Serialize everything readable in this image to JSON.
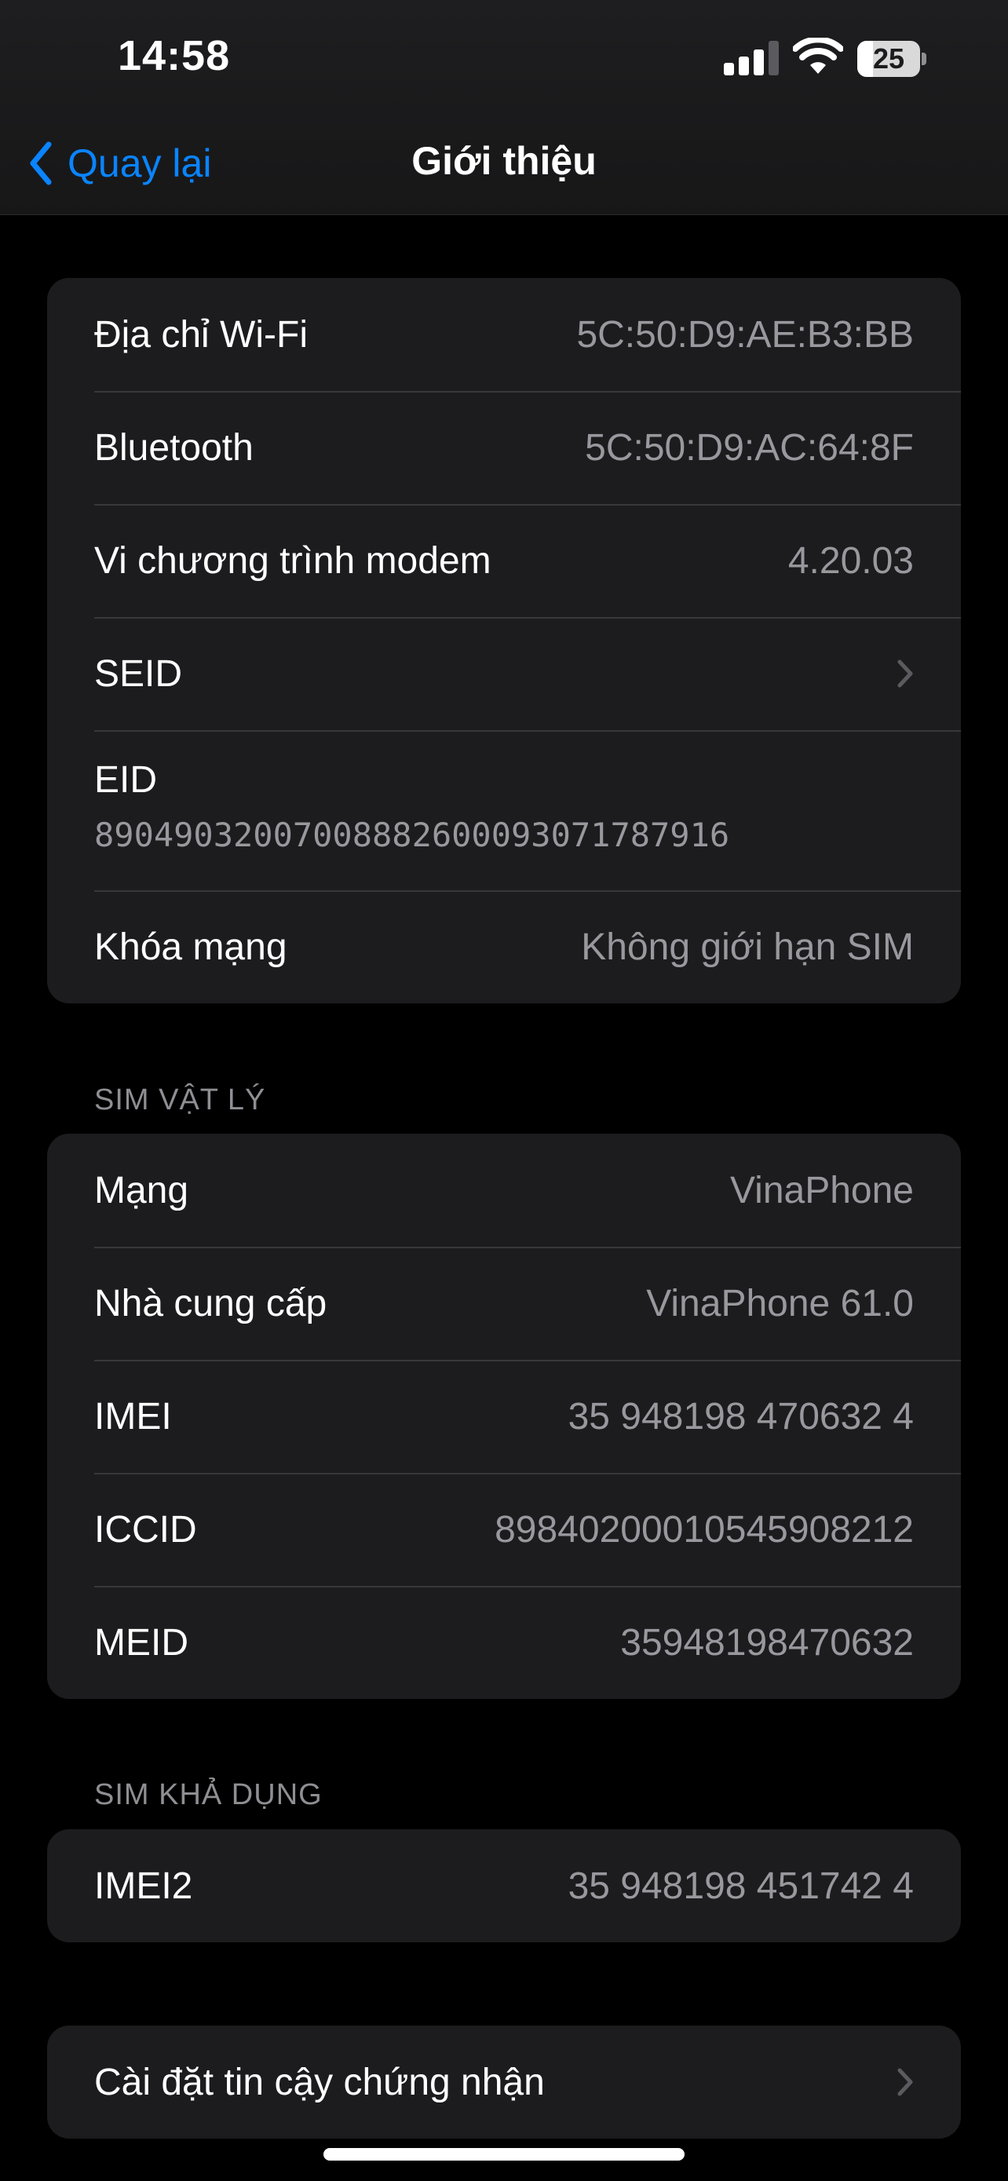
{
  "status_bar": {
    "time": "14:58",
    "battery_level": "25",
    "battery_fraction": 0.25,
    "signal_bars_active": 3,
    "signal_bars_total": 4
  },
  "nav": {
    "back_label": "Quay lại",
    "title": "Giới thiệu"
  },
  "colors": {
    "accent": "#0a84ff",
    "background": "#000000",
    "cell_background": "#1c1c1e",
    "secondary_text": "#98989e",
    "separator": "#38383a"
  },
  "group1": {
    "rows": [
      {
        "label": "Địa chỉ Wi-Fi",
        "value": "5C:50:D9:AE:B3:BB"
      },
      {
        "label": "Bluetooth",
        "value": "5C:50:D9:AC:64:8F"
      },
      {
        "label": "Vi chương trình modem",
        "value": "4.20.03"
      },
      {
        "label": "SEID",
        "icon": "chevron-right-icon"
      },
      {
        "label": "EID",
        "value": "89049032007008882600093071787916"
      },
      {
        "label": "Khóa mạng",
        "value": "Không giới hạn SIM"
      }
    ]
  },
  "physical_sim": {
    "header": "SIM VẬT LÝ",
    "rows": [
      {
        "label": "Mạng",
        "value": "VinaPhone"
      },
      {
        "label": "Nhà cung cấp",
        "value": "VinaPhone 61.0"
      },
      {
        "label": "IMEI",
        "value": "35 948198 470632 4"
      },
      {
        "label": "ICCID",
        "value": "89840200010545908212"
      },
      {
        "label": "MEID",
        "value": "35948198470632"
      }
    ]
  },
  "available_sim": {
    "header": "SIM KHẢ DỤNG",
    "rows": [
      {
        "label": "IMEI2",
        "value": "35 948198 451742 4"
      }
    ]
  },
  "certificate": {
    "label": "Cài đặt tin cậy chứng nhận",
    "icon": "chevron-right-icon"
  }
}
